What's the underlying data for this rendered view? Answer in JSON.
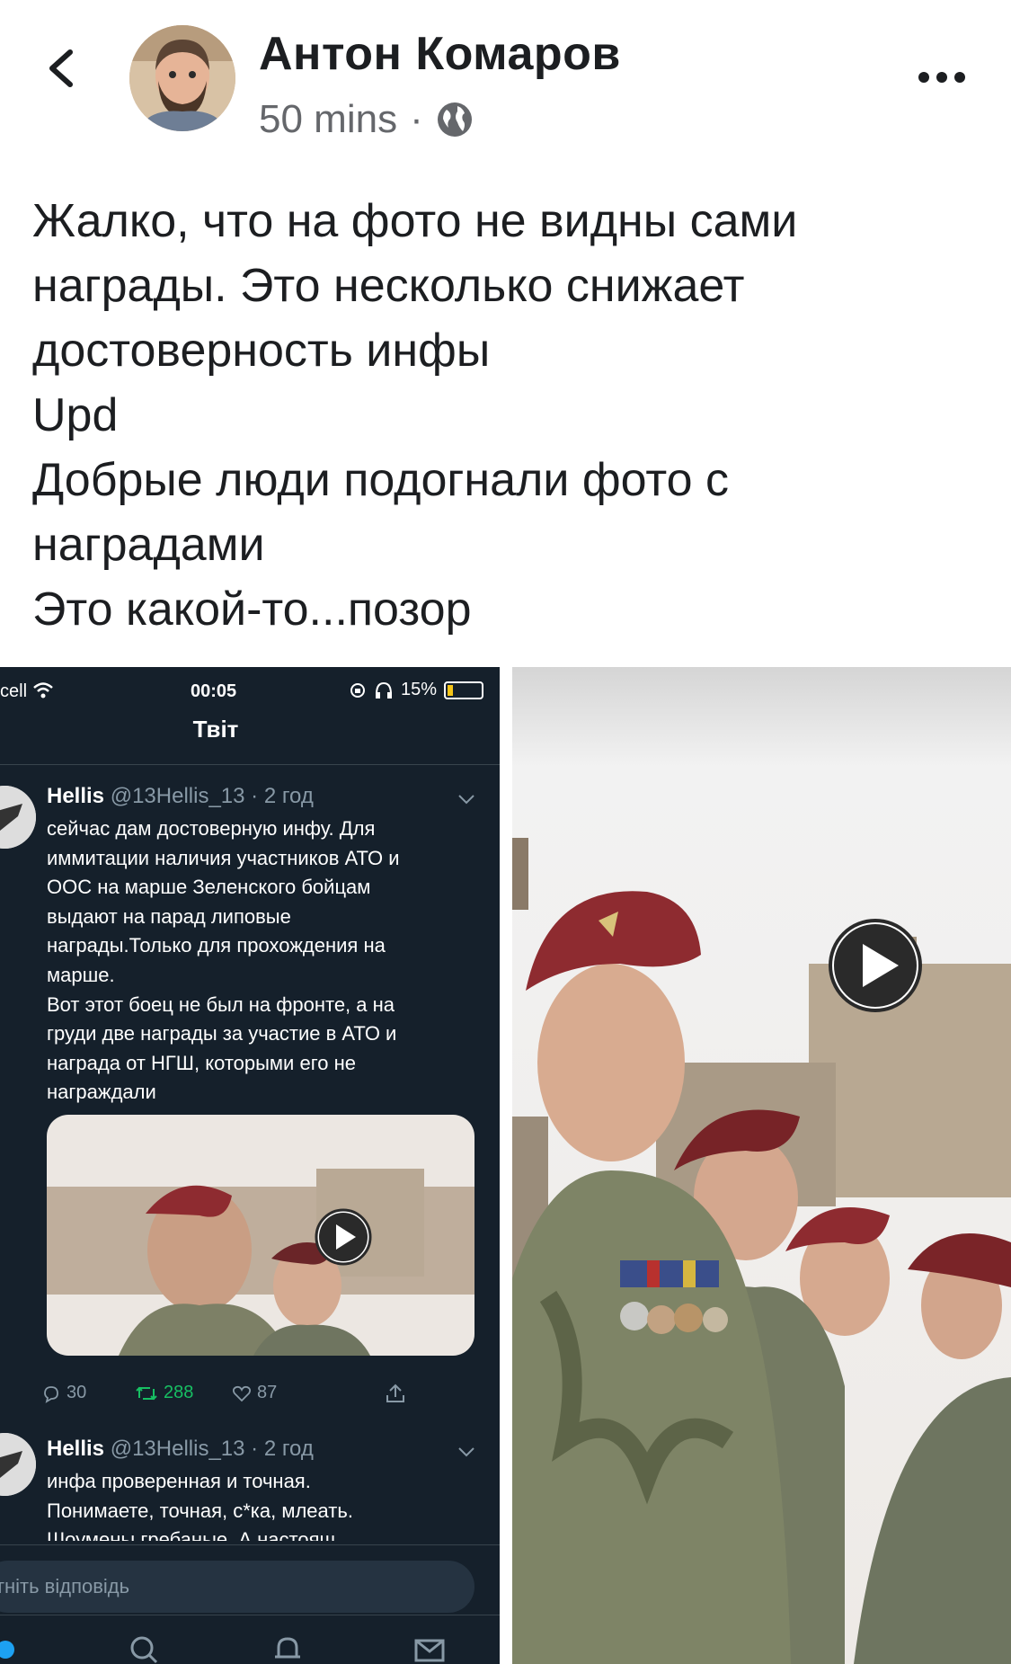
{
  "post": {
    "author": "Антон Комаров",
    "time": "50 mins",
    "separator": "·",
    "privacy_icon": "globe-icon",
    "text_lines": [
      "Жалко, что на фото не видны сами",
      "награды. Это несколько снижает",
      "достоверность инфы",
      "Upd",
      "Добрые люди подогнали фото с",
      "наградами",
      "Это какой-то...позор"
    ]
  },
  "twitter": {
    "status": {
      "carrier": "cell",
      "time": "00:05",
      "battery": "15%"
    },
    "title": "Твіт",
    "tweets": [
      {
        "name": "Hellis",
        "handle": "@13Hellis_13",
        "age": "· 2 год",
        "lines": [
          "сейчас дам достоверную инфу. Для",
          "иммитации наличия участников АТО и",
          "ООС на марше Зеленского бойцам",
          "выдают на парад липовые",
          "награды.Только для прохождения на",
          "марше.",
          "Вот этот боец не был на фронте, а на",
          "груди две награды за участие в АТО и",
          "награда от НГШ, которыми его не",
          "награждали"
        ],
        "replies": "30",
        "retweets": "288",
        "likes": "87"
      },
      {
        "name": "Hellis",
        "handle": "@13Hellis_13",
        "age": "· 2 год",
        "lines": [
          "инфа проверенная и точная.",
          "Понимаете, точная, с*ка, млеать.",
          "Шоумены гребаные. А настоящ"
        ]
      }
    ],
    "reply_placeholder": "ітніть відповідь"
  },
  "colors": {
    "twitter_bg": "#15202b",
    "retweet_green": "#17bf63",
    "beret": "#8e2b30"
  }
}
